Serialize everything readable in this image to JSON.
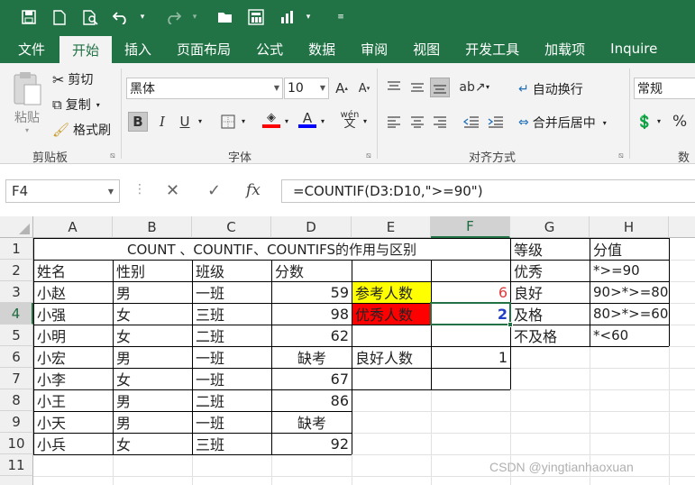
{
  "quick_access": {
    "icons": [
      "save-icon",
      "new-file-icon",
      "print-preview-icon",
      "undo-icon",
      "redo-icon",
      "open-folder-icon",
      "form-icon",
      "sort-icon",
      "customize-icon"
    ]
  },
  "tabs": [
    "文件",
    "开始",
    "插入",
    "页面布局",
    "公式",
    "数据",
    "审阅",
    "视图",
    "开发工具",
    "加载项",
    "Inquire"
  ],
  "active_tab": "开始",
  "ribbon": {
    "clipboard": {
      "paste": "粘贴",
      "cut": "剪切",
      "copy": "复制",
      "format_painter": "格式刷",
      "label": "剪贴板"
    },
    "font": {
      "font_name": "黑体",
      "font_size": "10",
      "label": "字体"
    },
    "alignment": {
      "wrap": "自动换行",
      "merge": "合并后居中",
      "label": "对齐方式"
    },
    "number": {
      "format": "常规",
      "percent": "%",
      "label": "数"
    },
    "colors": {
      "fill": "#ff0000",
      "font": "#0000ff"
    }
  },
  "formula_bar": {
    "name_box": "F4",
    "formula": "=COUNTIF(D3:D10,\">=90\")",
    "fx": "fx"
  },
  "columns": [
    "A",
    "B",
    "C",
    "D",
    "E",
    "F",
    "G",
    "H"
  ],
  "rows": [
    "1",
    "2",
    "3",
    "4",
    "5",
    "6",
    "7",
    "8",
    "9",
    "10",
    "11"
  ],
  "selected_cell": {
    "col": "F",
    "row": "4"
  },
  "cells": {
    "title": "COUNT 、COUNTIF、COUNTIFS的作用与区别",
    "headers": [
      "姓名",
      "性别",
      "班级",
      "分数"
    ],
    "data": [
      [
        "小赵",
        "男",
        "一班",
        "59"
      ],
      [
        "小强",
        "女",
        "三班",
        "98"
      ],
      [
        "小明",
        "女",
        "二班",
        "62"
      ],
      [
        "小宏",
        "男",
        "一班",
        "缺考"
      ],
      [
        "小李",
        "女",
        "一班",
        "67"
      ],
      [
        "小王",
        "男",
        "二班",
        "86"
      ],
      [
        "小天",
        "男",
        "一班",
        "缺考"
      ],
      [
        "小兵",
        "女",
        "三班",
        "92"
      ]
    ],
    "e3": "参考人数",
    "f3": "6",
    "e4": "优秀人数",
    "f4": "2",
    "e6": "良好人数",
    "f6": "1",
    "g_header": "等级",
    "h_header": "分值",
    "grades": [
      [
        "优秀",
        "*>=90"
      ],
      [
        "良好",
        "90>*>=80"
      ],
      [
        "及格",
        "80>*>=60"
      ],
      [
        "不及格",
        "*<60"
      ]
    ],
    "e3_fill": "#ffff00",
    "e4_fill": "#ff0000"
  },
  "watermark": "CSDN @yingtianhaoxuan"
}
